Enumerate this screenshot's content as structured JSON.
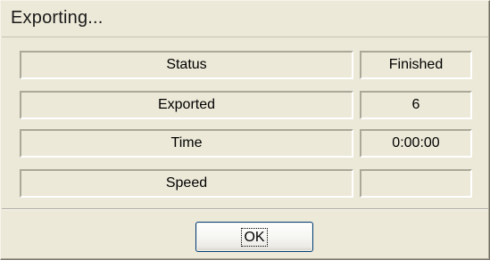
{
  "dialog": {
    "title": "Exporting...",
    "rows": [
      {
        "label": "Status",
        "value": "Finished"
      },
      {
        "label": "Exported",
        "value": "6"
      },
      {
        "label": "Time",
        "value": "0:00:00"
      },
      {
        "label": "Speed",
        "value": ""
      }
    ],
    "ok_label": "OK"
  },
  "colors": {
    "dialog_background": "#ECE9D8",
    "button_border": "#003c74"
  }
}
